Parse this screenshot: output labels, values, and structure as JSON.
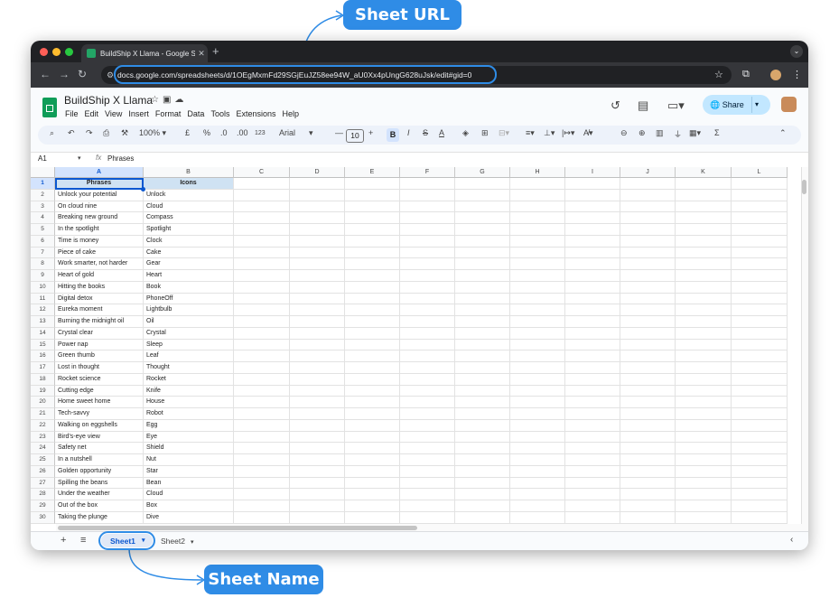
{
  "annotations": {
    "url_callout": "Sheet URL",
    "name_callout": "Sheet Name"
  },
  "browser": {
    "tab_title": "BuildShip X Llama - Google Sh",
    "url": "docs.google.com/spreadsheets/d/1OEgMxmFd29SGjEuJZ58ee94W_aU0Xx4pUngG628uJsk/edit#gid=0"
  },
  "doc": {
    "title": "BuildShip X Llama",
    "menu": [
      "File",
      "Edit",
      "View",
      "Insert",
      "Format",
      "Data",
      "Tools",
      "Extensions",
      "Help"
    ],
    "share_label": "Share"
  },
  "toolbar": {
    "zoom": "100%",
    "currency": "£",
    "percent": "%",
    "dec_decrease": ".0",
    "dec_increase": ".00",
    "number_format": "123",
    "font": "Arial",
    "font_size": "10"
  },
  "formula_bar": {
    "name_box": "A1",
    "value": "Phrases"
  },
  "columns": [
    "A",
    "B",
    "C",
    "D",
    "E",
    "F",
    "G",
    "H",
    "I",
    "J",
    "K",
    "L"
  ],
  "row_numbers": [
    1,
    2,
    3,
    4,
    5,
    6,
    7,
    8,
    9,
    10,
    11,
    12,
    13,
    14,
    15,
    16,
    17,
    18,
    19,
    20,
    21,
    22,
    23,
    24,
    25,
    26,
    27,
    28,
    29,
    30
  ],
  "rows": [
    [
      "Phrases",
      "Icons"
    ],
    [
      "Unlock your potential",
      "Unlock"
    ],
    [
      "On cloud nine",
      "Cloud"
    ],
    [
      "Breaking new ground",
      "Compass"
    ],
    [
      "In the spotlight",
      "Spotlight"
    ],
    [
      "Time is money",
      "Clock"
    ],
    [
      "Piece of cake",
      "Cake"
    ],
    [
      "Work smarter, not harder",
      "Gear"
    ],
    [
      "Heart of gold",
      "Heart"
    ],
    [
      "Hitting the books",
      "Book"
    ],
    [
      "Digital detox",
      "PhoneOff"
    ],
    [
      "Eureka moment",
      "Lightbulb"
    ],
    [
      "Burning the midnight oil",
      "Oil"
    ],
    [
      "Crystal clear",
      "Crystal"
    ],
    [
      "Power nap",
      "Sleep"
    ],
    [
      "Green thumb",
      "Leaf"
    ],
    [
      "Lost in thought",
      "Thought"
    ],
    [
      "Rocket science",
      "Rocket"
    ],
    [
      "Cutting edge",
      "Knife"
    ],
    [
      "Home sweet home",
      "House"
    ],
    [
      "Tech-savvy",
      "Robot"
    ],
    [
      "Walking on eggshells",
      "Egg"
    ],
    [
      "Bird's-eye view",
      "Eye"
    ],
    [
      "Safety net",
      "Shield"
    ],
    [
      "In a nutshell",
      "Nut"
    ],
    [
      "Golden opportunity",
      "Star"
    ],
    [
      "Spilling the beans",
      "Bean"
    ],
    [
      "Under the weather",
      "Cloud"
    ],
    [
      "Out of the box",
      "Box"
    ],
    [
      "Taking the plunge",
      "Dive"
    ]
  ],
  "sheets": [
    "Sheet1",
    "Sheet2"
  ],
  "colors": {
    "callout": "#2f8ce6",
    "header_fill": "#cfe2f3",
    "share_button": "#c2e7ff",
    "selection": "#0b57d0"
  }
}
